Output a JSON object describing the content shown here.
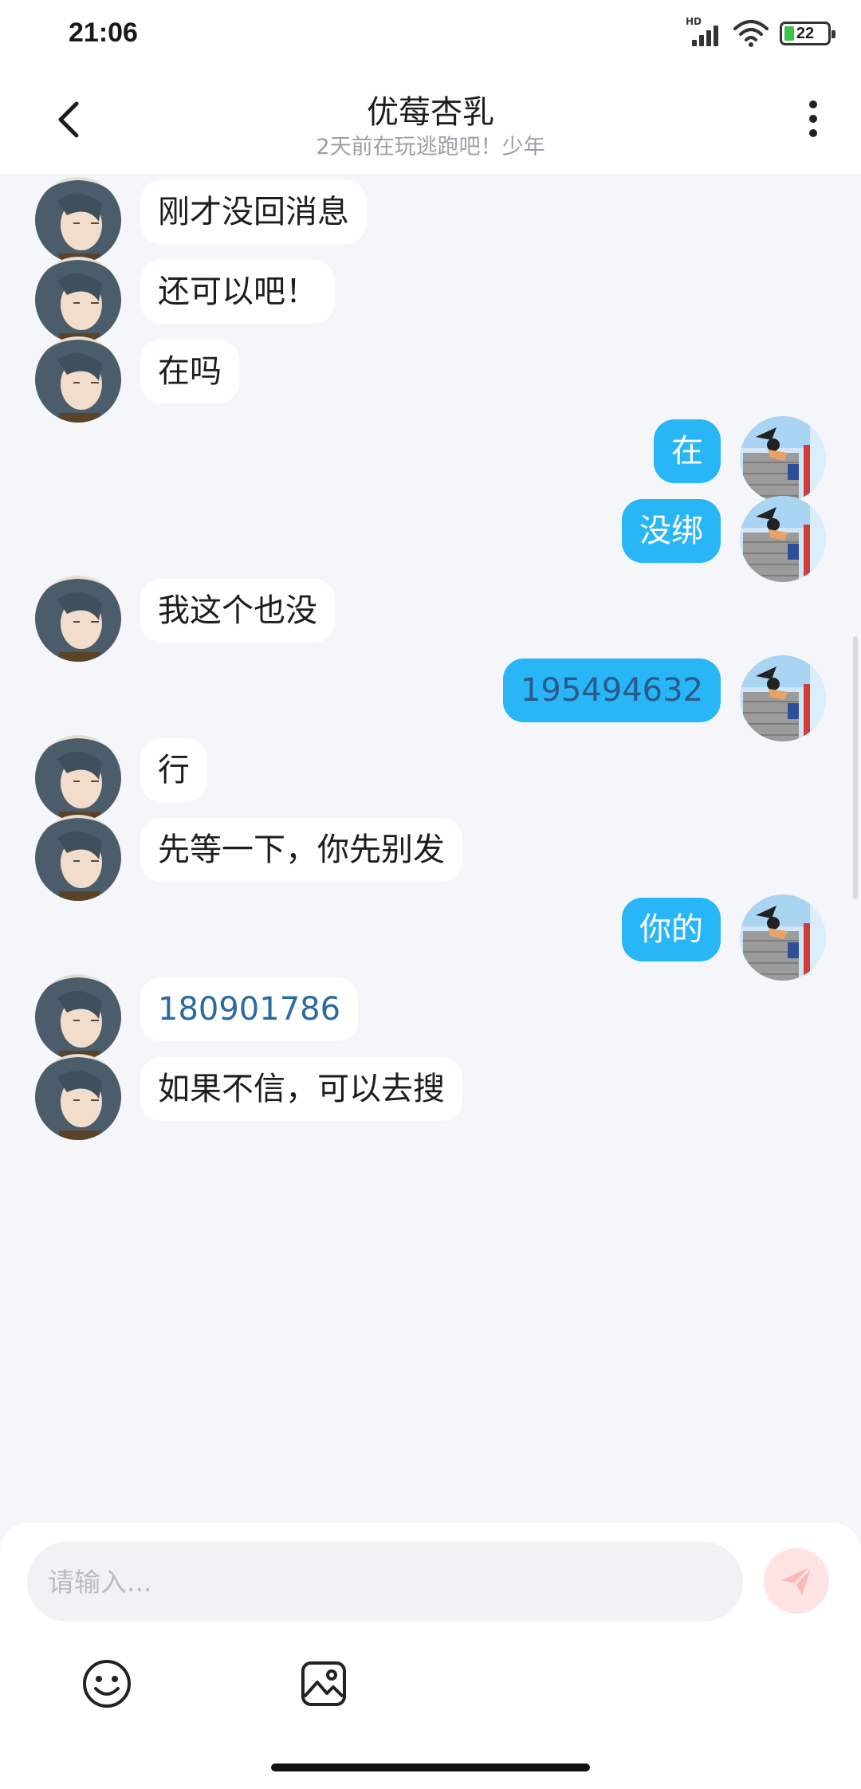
{
  "status_bar": {
    "time": "21:06",
    "signal_label": "HD",
    "battery_level": "22"
  },
  "header": {
    "title": "优莓杏乳",
    "subtitle": "2天前在玩逃跑吧！少年"
  },
  "messages": [
    {
      "side": "left",
      "text": "刚才没回消息"
    },
    {
      "side": "left",
      "text": "还可以吧！"
    },
    {
      "side": "left",
      "text": "在吗"
    },
    {
      "side": "right",
      "text": "在"
    },
    {
      "side": "right",
      "text": "没绑"
    },
    {
      "side": "left",
      "text": "我这个也没"
    },
    {
      "side": "right",
      "text": "195494632"
    },
    {
      "side": "left",
      "text": "行"
    },
    {
      "side": "left",
      "text": "先等一下，你先别发"
    },
    {
      "side": "right",
      "text": "你的"
    },
    {
      "side": "left",
      "text": "180901786"
    },
    {
      "side": "left",
      "text": "如果不信，可以去搜"
    }
  ],
  "composer": {
    "placeholder": "请输入..."
  },
  "icons": {
    "back": "chevron-left-icon",
    "more": "more-vertical-icon",
    "send": "send-icon",
    "emoji": "smile-icon",
    "image": "image-icon"
  },
  "colors": {
    "my_bubble": "#29b6f6",
    "their_bubble": "#ffffff",
    "background": "#f4f6f9"
  }
}
